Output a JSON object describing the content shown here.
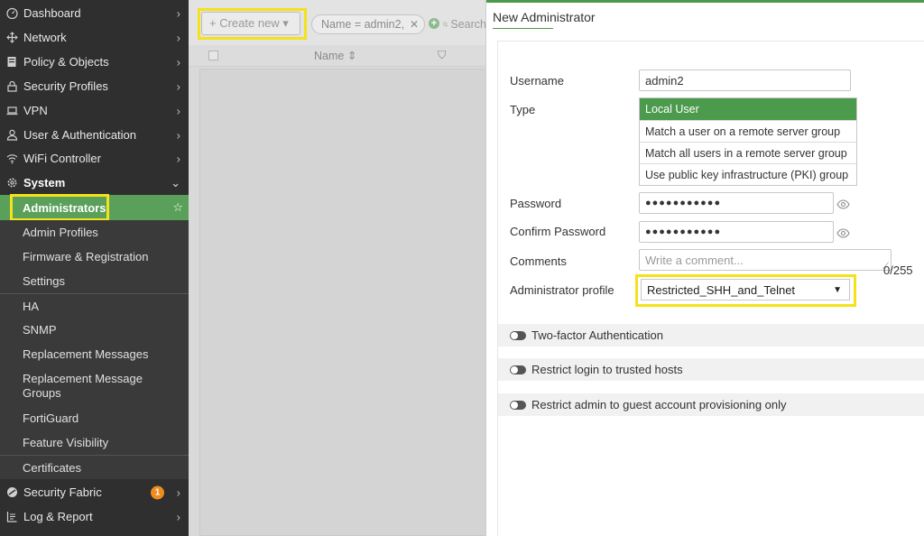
{
  "sidebar": {
    "items": [
      {
        "label": "Dashboard",
        "icon": "dashboard-icon",
        "chevron": "›"
      },
      {
        "label": "Network",
        "icon": "network-icon",
        "chevron": "›"
      },
      {
        "label": "Policy & Objects",
        "icon": "policy-icon",
        "chevron": "›"
      },
      {
        "label": "Security Profiles",
        "icon": "lock-icon",
        "chevron": "›"
      },
      {
        "label": "VPN",
        "icon": "laptop-icon",
        "chevron": "›"
      },
      {
        "label": "User & Authentication",
        "icon": "user-icon",
        "chevron": "›"
      },
      {
        "label": "WiFi Controller",
        "icon": "wifi-icon",
        "chevron": "›"
      },
      {
        "label": "System",
        "icon": "gear-icon",
        "chevron": "⌄"
      }
    ],
    "system_sub": [
      "Administrators",
      "Admin Profiles",
      "Firmware & Registration",
      "Settings",
      "HA",
      "SNMP",
      "Replacement Messages",
      "Replacement Message Groups",
      "FortiGuard",
      "Feature Visibility",
      "Certificates"
    ],
    "bottom_items": [
      {
        "label": "Security Fabric",
        "icon": "fabric-icon",
        "badge": "1",
        "chevron": "›"
      },
      {
        "label": "Log & Report",
        "icon": "log-icon",
        "chevron": "›"
      }
    ]
  },
  "list": {
    "create_new": "+ Create new ▾",
    "filter": "Name = admin2,",
    "filter_clear": "✕",
    "add_filter": "+",
    "search": "Search",
    "column_name": "Name ⇕",
    "column_filter": "⛉"
  },
  "panel": {
    "title": "New Administrator",
    "username_label": "Username",
    "username_value": "admin2",
    "type_label": "Type",
    "type_options": [
      "Local User",
      "Match a user on a remote server group",
      "Match all users in a remote server group",
      "Use public key infrastructure (PKI) group"
    ],
    "password_label": "Password",
    "password_value": "●●●●●●●●●●●",
    "confirm_label": "Confirm Password",
    "confirm_value": "●●●●●●●●●●●",
    "comments_label": "Comments",
    "comments_placeholder": "Write a comment...",
    "comments_counter": "0/255",
    "profile_label": "Administrator profile",
    "profile_value": "Restricted_SHH_and_Telnet",
    "toggles": [
      "Two-factor Authentication",
      "Restrict login to trusted hosts",
      "Restrict admin to guest account provisioning only"
    ]
  },
  "colors": {
    "accent_green": "#4c9a4c",
    "highlight_yellow": "#f4e21b",
    "badge_orange": "#f08c1e",
    "sidebar_bg": "#2f2f2f"
  }
}
